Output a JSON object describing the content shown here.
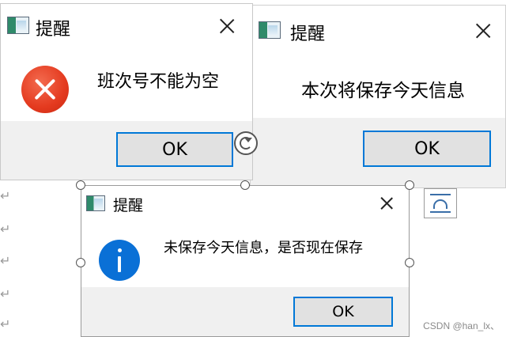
{
  "dialogs": [
    {
      "title": "提醒",
      "message": "班次号不能为空",
      "ok_label": "OK",
      "icon": "error-icon"
    },
    {
      "title": "提醒",
      "message": "本次将保存今天信息",
      "ok_label": "OK",
      "icon": "none"
    },
    {
      "title": "提醒",
      "message": "未保存今天信息，是否现在保存",
      "ok_label": "OK",
      "icon": "info-icon"
    }
  ],
  "background": {
    "paragraph_mark": "↵"
  },
  "watermark": "CSDN @han_lx、",
  "colors": {
    "accent": "#0078d7",
    "error": "#e43a1f",
    "info": "#0a70d6",
    "footer": "#f0f0f0"
  }
}
